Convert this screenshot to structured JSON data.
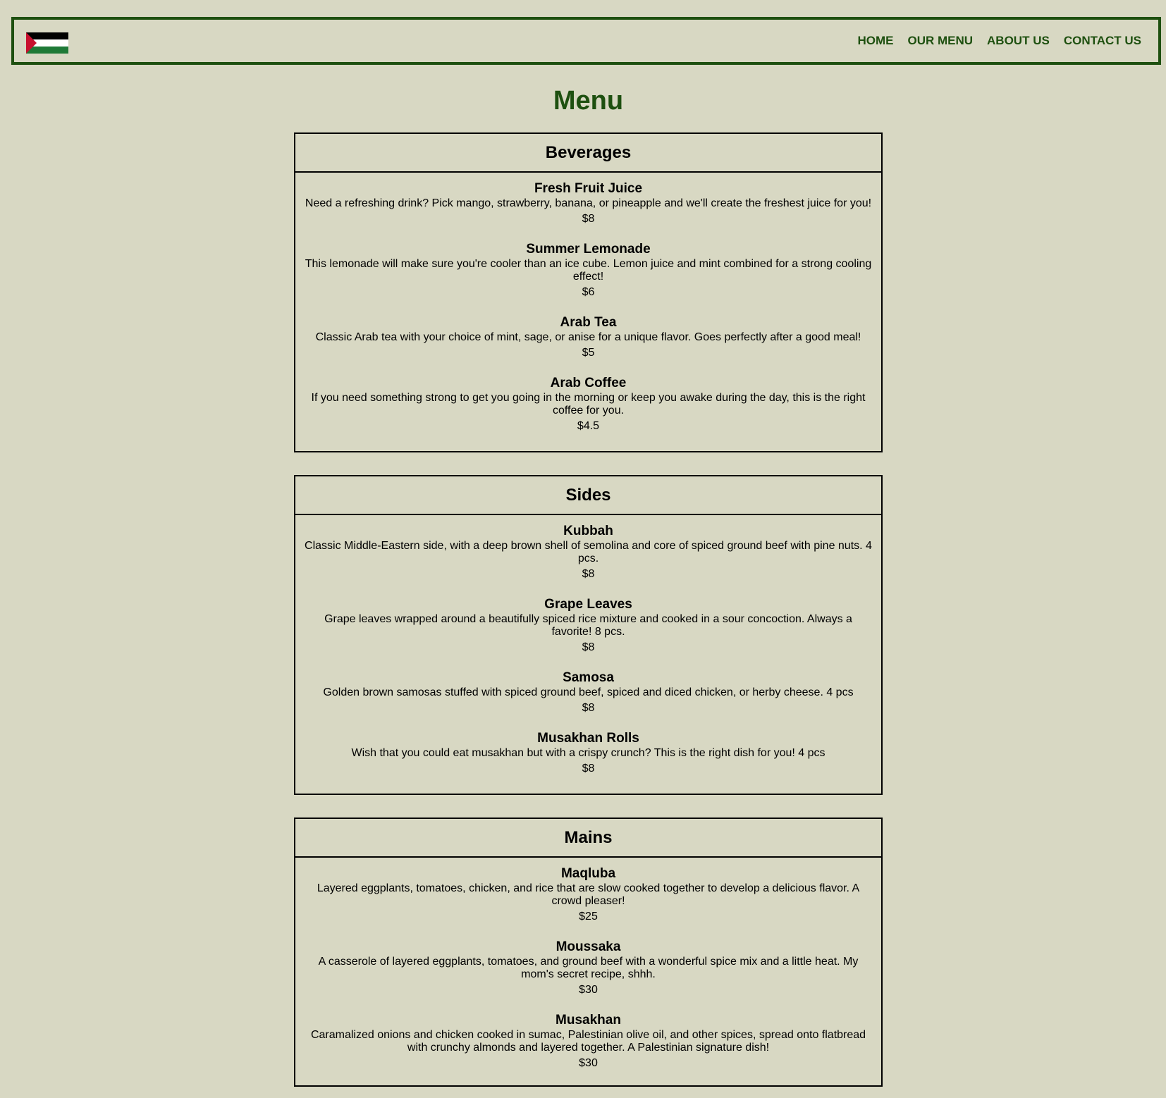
{
  "header": {
    "nav": [
      {
        "label": "HOME"
      },
      {
        "label": "OUR MENU"
      },
      {
        "label": "ABOUT US"
      },
      {
        "label": "CONTACT US"
      }
    ]
  },
  "page_title": "Menu",
  "colors": {
    "background": "#d8d8c3",
    "accent": "#1e5010",
    "flag_black": "#000000",
    "flag_white": "#ffffff",
    "flag_green": "#1f7a37",
    "flag_red": "#c8102e"
  },
  "sections": [
    {
      "title": "Beverages",
      "items": [
        {
          "name": "Fresh Fruit Juice",
          "description": "Need a refreshing drink? Pick mango, strawberry, banana, or pineapple and we'll create the freshest juice for you!",
          "price": "$8"
        },
        {
          "name": "Summer Lemonade",
          "description": "This lemonade will make sure you're cooler than an ice cube. Lemon juice and mint combined for a strong cooling effect!",
          "price": "$6"
        },
        {
          "name": "Arab Tea",
          "description": "Classic Arab tea with your choice of mint, sage, or anise for a unique flavor. Goes perfectly after a good meal!",
          "price": "$5"
        },
        {
          "name": "Arab Coffee",
          "description": "If you need something strong to get you going in the morning or keep you awake during the day, this is the right coffee for you.",
          "price": "$4.5"
        }
      ]
    },
    {
      "title": "Sides",
      "items": [
        {
          "name": "Kubbah",
          "description": "Classic Middle-Eastern side, with a deep brown shell of semolina and core of spiced ground beef with pine nuts. 4 pcs.",
          "price": "$8"
        },
        {
          "name": "Grape Leaves",
          "description": "Grape leaves wrapped around a beautifully spiced rice mixture and cooked in a sour concoction. Always a favorite! 8 pcs.",
          "price": "$8"
        },
        {
          "name": "Samosa",
          "description": "Golden brown samosas stuffed with spiced ground beef, spiced and diced chicken, or herby cheese. 4 pcs",
          "price": "$8"
        },
        {
          "name": "Musakhan Rolls",
          "description": "Wish that you could eat musakhan but with a crispy crunch? This is the right dish for you! 4 pcs",
          "price": "$8"
        }
      ]
    },
    {
      "title": "Mains",
      "items": [
        {
          "name": "Maqluba",
          "description": "Layered eggplants, tomatoes, chicken, and rice that are slow cooked together to develop a delicious flavor. A crowd pleaser!",
          "price": "$25"
        },
        {
          "name": "Moussaka",
          "description": "A casserole of layered eggplants, tomatoes, and ground beef with a wonderful spice mix and a little heat. My mom's secret recipe, shhh.",
          "price": "$30"
        },
        {
          "name": "Musakhan",
          "description": "Caramalized onions and chicken cooked in sumac, Palestinian olive oil, and other spices, spread onto flatbread with crunchy almonds and layered together. A Palestinian signature dish!",
          "price": "$30"
        }
      ]
    }
  ]
}
